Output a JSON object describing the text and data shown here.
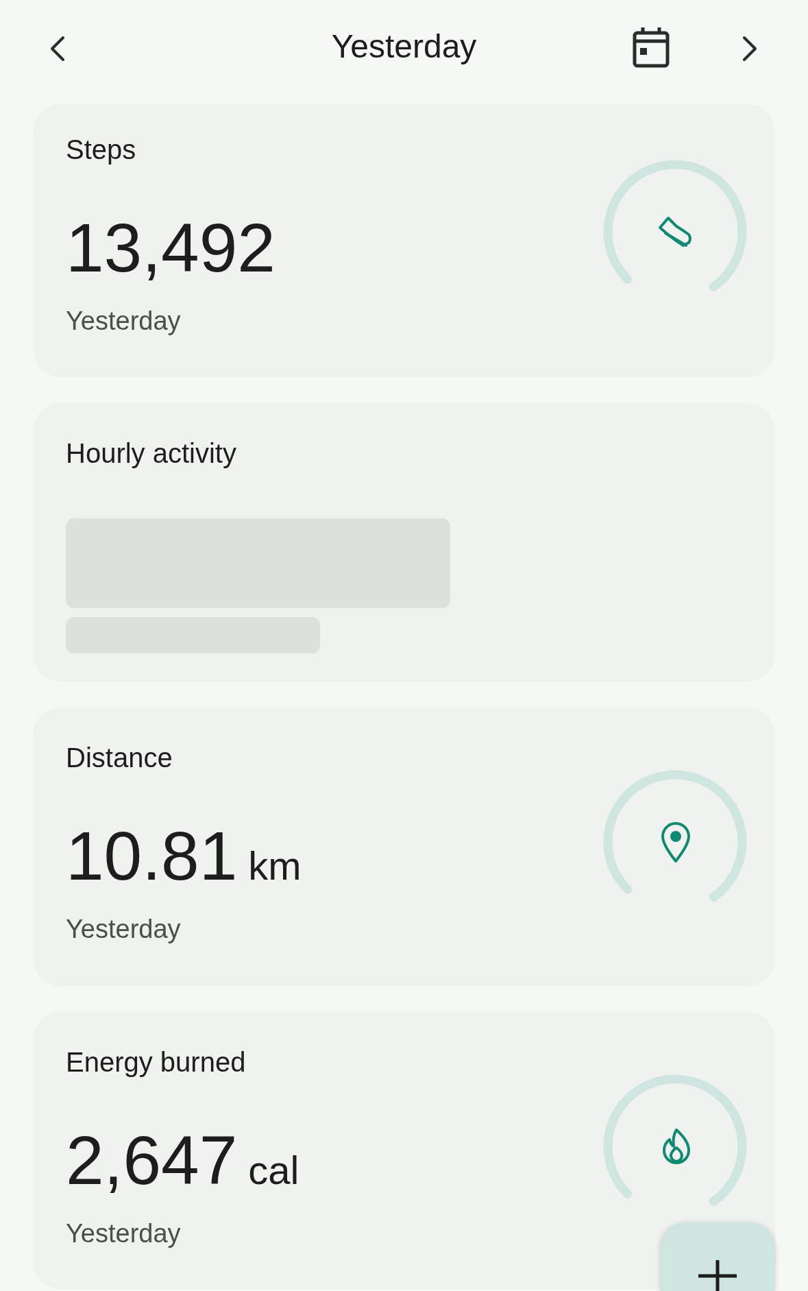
{
  "header": {
    "title": "Yesterday"
  },
  "cards": [
    {
      "kind": "metric",
      "title": "Steps",
      "value": "13,492",
      "subtitle": "Yesterday"
    },
    {
      "kind": "loading",
      "title": "Hourly activity"
    },
    {
      "kind": "metric",
      "title": "Distance",
      "value": "10.81",
      "unit": "km",
      "subtitle": "Yesterday"
    },
    {
      "kind": "metric",
      "title": "Energy burned",
      "value": "2,647",
      "unit": "cal",
      "subtitle": "Yesterday"
    }
  ]
}
